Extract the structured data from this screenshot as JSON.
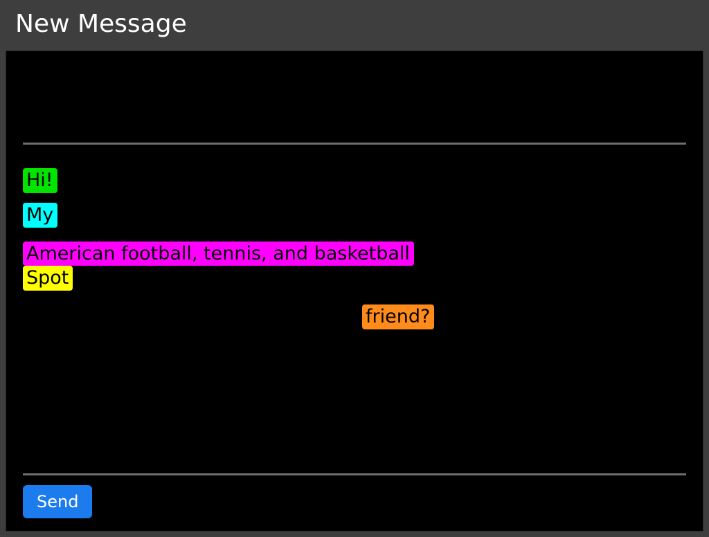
{
  "titlebar": {
    "title": "New Message"
  },
  "body": {
    "hl1": "Hi!",
    "hl2": "My",
    "hl3": "American football, tennis, and basketball",
    "hl4": "Spot",
    "hl5": "friend?"
  },
  "actions": {
    "send": "Send"
  }
}
